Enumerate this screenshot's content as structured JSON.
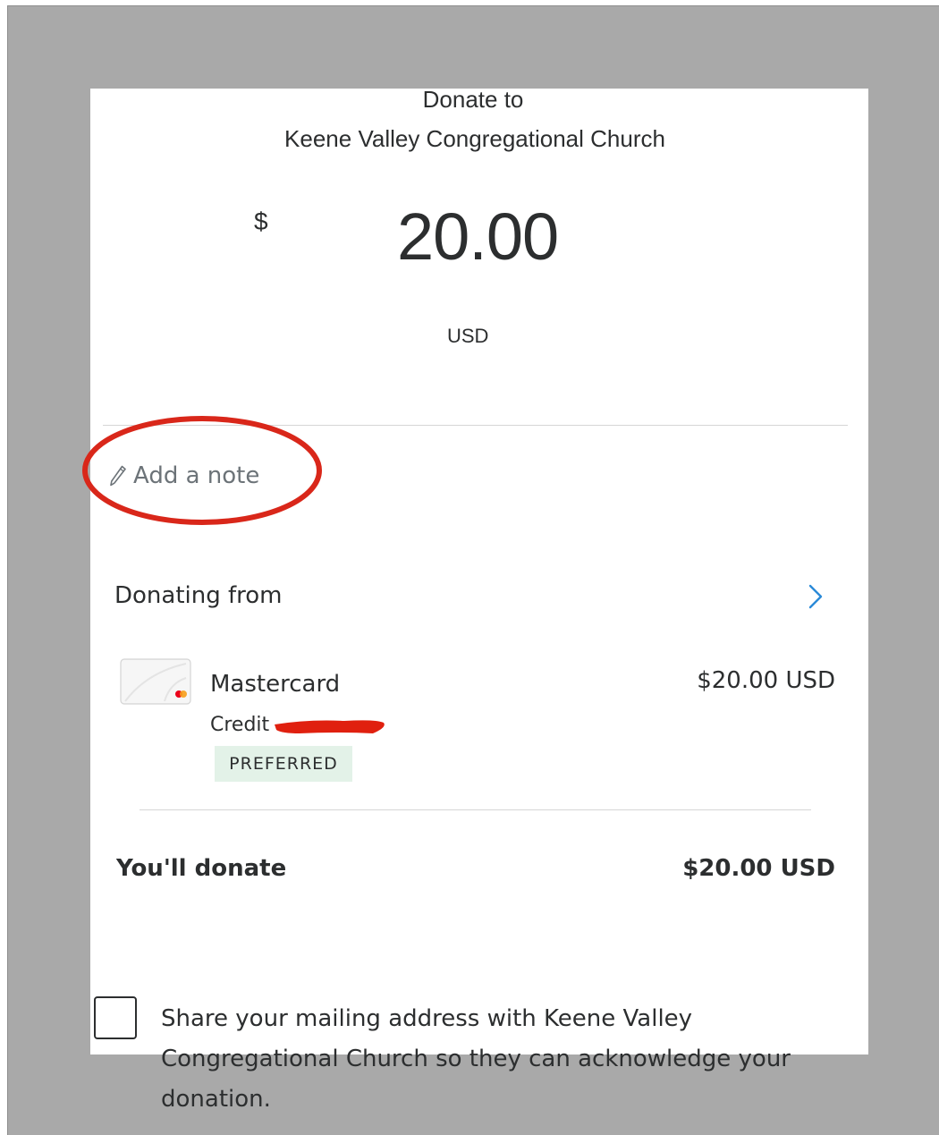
{
  "header": {
    "line1": "Donate to",
    "line2": "Keene Valley Congregational Church"
  },
  "amount": {
    "symbol": "$",
    "value": "20.00",
    "currency": "USD"
  },
  "note": {
    "label": "Add a note",
    "icon": "pencil-icon"
  },
  "donating_from": {
    "heading": "Donating from",
    "chevron_icon": "chevron-right-icon",
    "card": {
      "name": "Mastercard",
      "type": "Credit",
      "amount": "$20.00 USD",
      "badge": "PREFERRED"
    }
  },
  "total": {
    "label": "You'll donate",
    "amount": "$20.00 USD"
  },
  "share": {
    "checked": false,
    "text": "Share your mailing address with Keene Valley Congregational Church so they can acknowledge your donation."
  },
  "colors": {
    "annotation_red": "#d9271a",
    "link_blue": "#2b8ad8",
    "badge_bg": "#e3f2e8",
    "backdrop": "#a9a9a9"
  }
}
